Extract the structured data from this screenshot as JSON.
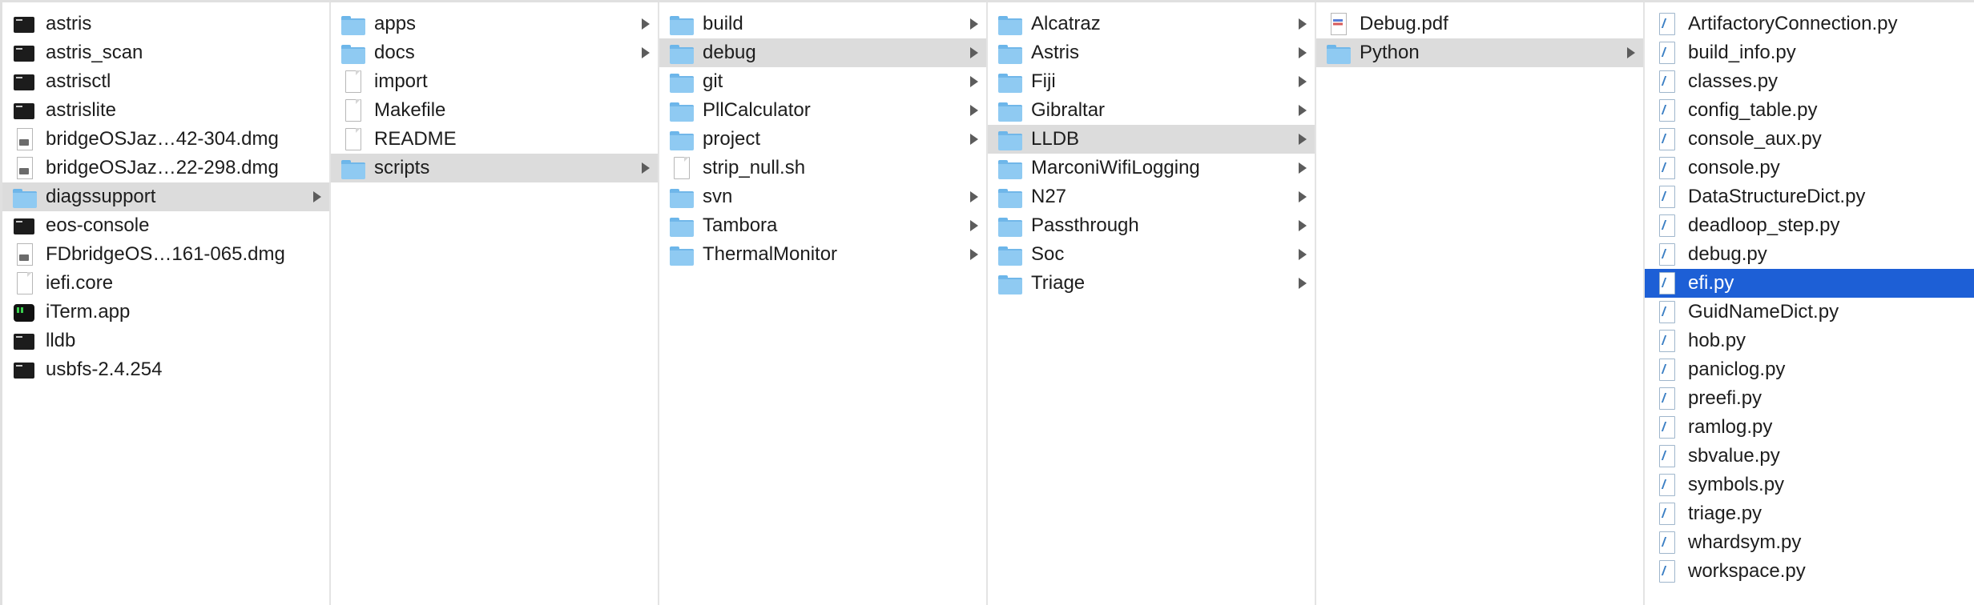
{
  "columns": [
    {
      "items": [
        {
          "label": "astris",
          "icon": "terminal-exec-icon",
          "kind": "exec"
        },
        {
          "label": "astris_scan",
          "icon": "terminal-exec-icon",
          "kind": "exec"
        },
        {
          "label": "astrisctl",
          "icon": "terminal-exec-icon",
          "kind": "exec"
        },
        {
          "label": "astrislite",
          "icon": "terminal-exec-icon",
          "kind": "exec"
        },
        {
          "label": "bridgeOSJaz…42-304.dmg",
          "icon": "disk-image-icon",
          "kind": "dmg"
        },
        {
          "label": "bridgeOSJaz…22-298.dmg",
          "icon": "disk-image-icon",
          "kind": "dmg"
        },
        {
          "label": "diagssupport",
          "icon": "folder-icon",
          "kind": "folder",
          "arrow": true,
          "selected": "gray"
        },
        {
          "label": "eos-console",
          "icon": "terminal-exec-icon",
          "kind": "exec"
        },
        {
          "label": "FDbridgeOS…161-065.dmg",
          "icon": "disk-image-icon",
          "kind": "dmg"
        },
        {
          "label": "iefi.core",
          "icon": "document-icon",
          "kind": "doc"
        },
        {
          "label": "iTerm.app",
          "icon": "iterm-app-icon",
          "kind": "app"
        },
        {
          "label": "lldb",
          "icon": "terminal-exec-icon",
          "kind": "exec"
        },
        {
          "label": "usbfs-2.4.254",
          "icon": "terminal-exec-icon",
          "kind": "exec"
        }
      ]
    },
    {
      "items": [
        {
          "label": "apps",
          "icon": "folder-icon",
          "kind": "folder",
          "arrow": true
        },
        {
          "label": "docs",
          "icon": "folder-icon",
          "kind": "folder",
          "arrow": true
        },
        {
          "label": "import",
          "icon": "document-icon",
          "kind": "doc"
        },
        {
          "label": "Makefile",
          "icon": "document-icon",
          "kind": "doc"
        },
        {
          "label": "README",
          "icon": "document-icon",
          "kind": "doc"
        },
        {
          "label": "scripts",
          "icon": "folder-icon",
          "kind": "folder",
          "arrow": true,
          "selected": "gray"
        }
      ]
    },
    {
      "items": [
        {
          "label": "build",
          "icon": "folder-icon",
          "kind": "folder",
          "arrow": true
        },
        {
          "label": "debug",
          "icon": "folder-icon",
          "kind": "folder",
          "arrow": true,
          "selected": "gray"
        },
        {
          "label": "git",
          "icon": "folder-icon",
          "kind": "folder",
          "arrow": true
        },
        {
          "label": "PllCalculator",
          "icon": "folder-icon",
          "kind": "folder",
          "arrow": true
        },
        {
          "label": "project",
          "icon": "folder-icon",
          "kind": "folder",
          "arrow": true
        },
        {
          "label": "strip_null.sh",
          "icon": "document-icon",
          "kind": "doc"
        },
        {
          "label": "svn",
          "icon": "folder-icon",
          "kind": "folder",
          "arrow": true
        },
        {
          "label": "Tambora",
          "icon": "folder-icon",
          "kind": "folder",
          "arrow": true
        },
        {
          "label": "ThermalMonitor",
          "icon": "folder-icon",
          "kind": "folder",
          "arrow": true
        }
      ]
    },
    {
      "items": [
        {
          "label": "Alcatraz",
          "icon": "folder-icon",
          "kind": "folder",
          "arrow": true
        },
        {
          "label": "Astris",
          "icon": "folder-icon",
          "kind": "folder",
          "arrow": true
        },
        {
          "label": "Fiji",
          "icon": "folder-icon",
          "kind": "folder",
          "arrow": true
        },
        {
          "label": "Gibraltar",
          "icon": "folder-icon",
          "kind": "folder",
          "arrow": true
        },
        {
          "label": "LLDB",
          "icon": "folder-icon",
          "kind": "folder",
          "arrow": true,
          "selected": "gray"
        },
        {
          "label": "MarconiWifiLogging",
          "icon": "folder-icon",
          "kind": "folder",
          "arrow": true
        },
        {
          "label": "N27",
          "icon": "folder-icon",
          "kind": "folder",
          "arrow": true
        },
        {
          "label": "Passthrough",
          "icon": "folder-icon",
          "kind": "folder",
          "arrow": true
        },
        {
          "label": "Soc",
          "icon": "folder-icon",
          "kind": "folder",
          "arrow": true
        },
        {
          "label": "Triage",
          "icon": "folder-icon",
          "kind": "folder",
          "arrow": true
        }
      ]
    },
    {
      "items": [
        {
          "label": "Debug.pdf",
          "icon": "pdf-icon",
          "kind": "pdf"
        },
        {
          "label": "Python",
          "icon": "folder-icon",
          "kind": "folder",
          "arrow": true,
          "selected": "gray"
        }
      ]
    },
    {
      "items": [
        {
          "label": "ArtifactoryConnection.py",
          "icon": "python-file-icon",
          "kind": "py"
        },
        {
          "label": "build_info.py",
          "icon": "python-file-icon",
          "kind": "py"
        },
        {
          "label": "classes.py",
          "icon": "python-file-icon",
          "kind": "py"
        },
        {
          "label": "config_table.py",
          "icon": "python-file-icon",
          "kind": "py"
        },
        {
          "label": "console_aux.py",
          "icon": "python-file-icon",
          "kind": "py"
        },
        {
          "label": "console.py",
          "icon": "python-file-icon",
          "kind": "py"
        },
        {
          "label": "DataStructureDict.py",
          "icon": "python-file-icon",
          "kind": "py"
        },
        {
          "label": "deadloop_step.py",
          "icon": "python-file-icon",
          "kind": "py"
        },
        {
          "label": "debug.py",
          "icon": "python-file-icon",
          "kind": "py"
        },
        {
          "label": "efi.py",
          "icon": "python-file-icon",
          "kind": "py",
          "selected": "blue"
        },
        {
          "label": "GuidNameDict.py",
          "icon": "python-file-icon",
          "kind": "py"
        },
        {
          "label": "hob.py",
          "icon": "python-file-icon",
          "kind": "py"
        },
        {
          "label": "paniclog.py",
          "icon": "python-file-icon",
          "kind": "py"
        },
        {
          "label": "preefi.py",
          "icon": "python-file-icon",
          "kind": "py"
        },
        {
          "label": "ramlog.py",
          "icon": "python-file-icon",
          "kind": "py"
        },
        {
          "label": "sbvalue.py",
          "icon": "python-file-icon",
          "kind": "py"
        },
        {
          "label": "symbols.py",
          "icon": "python-file-icon",
          "kind": "py"
        },
        {
          "label": "triage.py",
          "icon": "python-file-icon",
          "kind": "py"
        },
        {
          "label": "whardsym.py",
          "icon": "python-file-icon",
          "kind": "py"
        },
        {
          "label": "workspace.py",
          "icon": "python-file-icon",
          "kind": "py"
        }
      ]
    }
  ],
  "colors": {
    "selection_active": "#1d5fd6",
    "selection_inactive": "#dcdcdc",
    "folder": "#8fcaf2"
  }
}
